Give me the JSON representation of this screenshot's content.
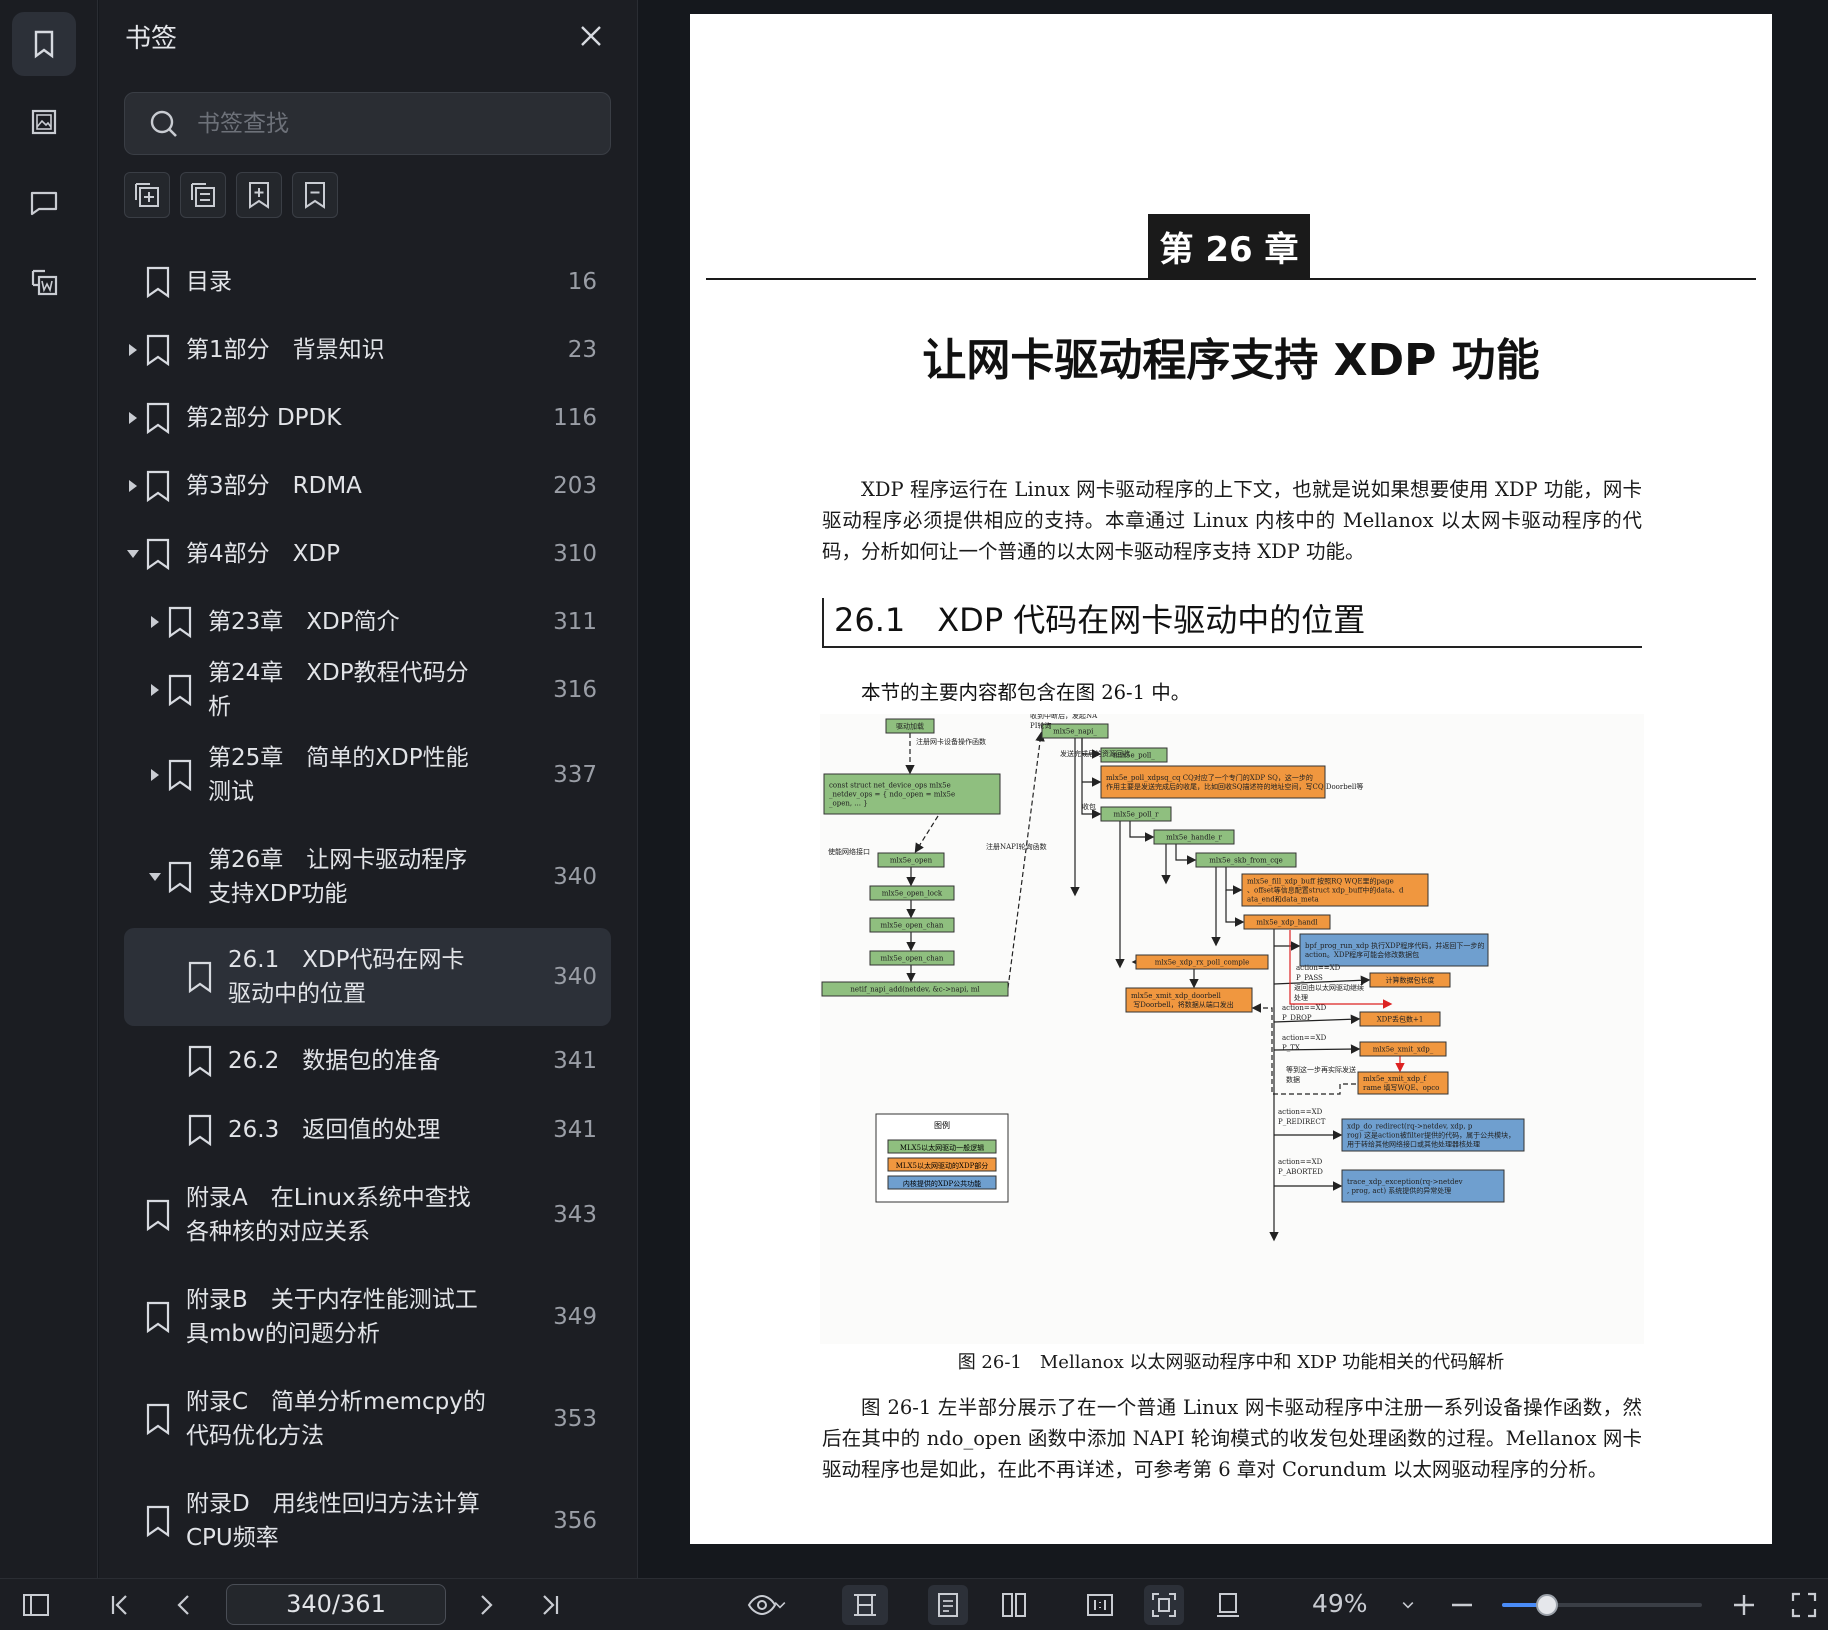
{
  "rail": {
    "items": [
      {
        "icon": "bookmark-icon",
        "active": true
      },
      {
        "icon": "image-icon",
        "active": false
      },
      {
        "icon": "comment-icon",
        "active": false
      },
      {
        "icon": "word-export-icon",
        "active": false
      }
    ]
  },
  "panel": {
    "title": "书签",
    "search_placeholder": "书签查找",
    "tools": [
      "add-bookmark-icon",
      "add-sub-bookmark-icon",
      "bookmark-plus-icon",
      "bookmark-remove-icon"
    ],
    "bookmarks": [
      {
        "label": "目录",
        "page": "16",
        "level": 0,
        "arrow": "none",
        "height": 68
      },
      {
        "label": "第1部分　背景知识",
        "page": "23",
        "level": 0,
        "arrow": "right",
        "height": 68
      },
      {
        "label": "第2部分 DPDK",
        "page": "116",
        "level": 0,
        "arrow": "right",
        "height": 68
      },
      {
        "label": "第3部分　RDMA",
        "page": "203",
        "level": 0,
        "arrow": "right",
        "height": 68
      },
      {
        "label": "第4部分　XDP",
        "page": "310",
        "level": 0,
        "arrow": "down",
        "height": 68
      },
      {
        "label": "第23章　XDP简介",
        "page": "311",
        "level": 1,
        "arrow": "right",
        "height": 68
      },
      {
        "label": "第24章　XDP教程代码分析",
        "page": "316",
        "level": 1,
        "arrow": "right",
        "height": 68
      },
      {
        "label": "第25章　简单的XDP性能测试",
        "page": "337",
        "level": 1,
        "arrow": "right",
        "height": 102
      },
      {
        "label": "第26章　让网卡驱动程序支持XDP功能",
        "page": "340",
        "level": 1,
        "arrow": "down",
        "height": 102
      },
      {
        "label": "26.1　XDP代码在网卡驱动中的位置",
        "page": "340",
        "level": 2,
        "arrow": "none",
        "height": 98,
        "selected": true
      },
      {
        "label": "26.2　数据包的准备",
        "page": "341",
        "level": 2,
        "arrow": "none",
        "height": 70
      },
      {
        "label": "26.3　返回值的处理",
        "page": "341",
        "level": 2,
        "arrow": "none",
        "height": 68
      },
      {
        "label": "附录A　在Linux系统中查找各种核的对应关系",
        "page": "343",
        "level": 0,
        "arrow": "none",
        "height": 102
      },
      {
        "label": "附录B　关于内存性能测试工具mbw的问题分析",
        "page": "349",
        "level": 0,
        "arrow": "none",
        "height": 102
      },
      {
        "label": "附录C　简单分析memcpy的代码优化方法",
        "page": "353",
        "level": 0,
        "arrow": "none",
        "height": 102
      },
      {
        "label": "附录D　用线性回归方法计算CPU频率",
        "page": "356",
        "level": 0,
        "arrow": "none",
        "height": 102
      }
    ]
  },
  "document": {
    "chapter_badge": "第 26 章",
    "chapter_title": "让网卡驱动程序支持 XDP 功能",
    "intro_paragraph": "XDP 程序运行在 Linux 网卡驱动程序的上下文，也就是说如果想要使用 XDP 功能，网卡驱动程序必须提供相应的支持。本章通过 Linux 内核中的 Mellanox 以太网卡驱动程序的代码，分析如何让一个普通的以太网卡驱动程序支持 XDP 功能。",
    "section_title": "26.1　XDP 代码在网卡驱动中的位置",
    "figure_intro": "本节的主要内容都包含在图 26-1 中。",
    "figure_caption": "图 26-1　Mellanox 以太网驱动程序中和 XDP 功能相关的代码解析",
    "body_paragraph": "图 26-1 左半部分展示了在一个普通 Linux 网卡驱动程序中注册一系列设备操作函数，然后在其中的 ndo_open 函数中添加 NAPI 轮询模式的收发包处理函数的过程。Mellanox 网卡驱动程序也是如此，在此不再详述，可参考第 6 章对 Corundum 以太网驱动程序的分析。",
    "figure": {
      "left_boxes": [
        {
          "text": "驱动加载"
        },
        {
          "text": "const struct net_device_ops mlx5e_netdev_ops = {  ndo_open = mlx5e_open,  ...  }"
        },
        {
          "text": "mlx5e_open"
        },
        {
          "text": "mlx5e_open_locked"
        },
        {
          "text": "mlx5e_open_channels"
        },
        {
          "text": "mlx5e_open_channel"
        },
        {
          "text": "netif_napi_add(netdev, &c->napi, mlx5e_napi_poll, 64)"
        }
      ],
      "left_labels": [
        "注册网卡设备操作函数",
        "使能网络接口",
        "注册NAPI轮询函数"
      ],
      "right_boxes": [
        {
          "text": "mlx5e_napi_poll",
          "kind": "green"
        },
        {
          "text": "mlx5e_poll_tx_cq",
          "kind": "green"
        },
        {
          "text": "mlx5e_poll_xdpsq_cq  CQ对应了一个专门的XDP SQ，这一步的作用主要是发送完成后的收尾，比如回收SQ描述符的地址空间，写CQ Doorbell等",
          "kind": "orange"
        },
        {
          "text": "mlx5e_poll_rx_cq",
          "kind": "green"
        },
        {
          "text": "mlx5e_handle_rx_cqe",
          "kind": "green"
        },
        {
          "text": "mlx5e_skb_from_cqe_linear",
          "kind": "green"
        },
        {
          "text": "mlx5e_fill_xdp_buff  按照RQ WQE里的page、offset等信息配置struct xdp_buff中的data、data_end和data_meta",
          "kind": "orange"
        },
        {
          "text": "mlx5e_xdp_handle",
          "kind": "orange"
        },
        {
          "text": "bpf_prog_run_xdp  执行XDP程序代码，并返回下一步的action。XDP程序可能会修改数据包",
          "kind": "blue"
        },
        {
          "text": "mlx5e_xdp_rx_poll_complete",
          "kind": "orange"
        },
        {
          "text": "mlx5e_xmit_xdp_doorbell  写Doorbell，将数据从端口发出",
          "kind": "orange"
        },
        {
          "text": "计算数据包长度",
          "kind": "orange"
        },
        {
          "text": "XDP丢包数+1",
          "kind": "orange"
        },
        {
          "text": "mlx5e_xmit_xdp_buff",
          "kind": "orange"
        },
        {
          "text": "mlx5e_xmit_xdp_frame  填写WQE、opcode等",
          "kind": "orange"
        },
        {
          "text": "xdp_do_redirect(rq->netdev, xdp, prog)  这是action被filter提供的代码，属于公共模块，用于转给其他网络接口或其他处理器核处理",
          "kind": "blue"
        },
        {
          "text": "trace_xdp_exception(rq->netdev, prog, act)  系统提供的异常处理",
          "kind": "blue"
        }
      ],
      "right_labels": [
        "收到中断后，发起NAPI轮询",
        "发送完成后的资源回收",
        "收包",
        "action==XDP_PASS",
        "返回由以太网驱动继续处理",
        "action==XDP_DROP",
        "action==XDP_TX",
        "等到这一步再实际发送数据",
        "action==XDP_REDIRECT",
        "action==XDP_ABORTED"
      ],
      "legend": {
        "title": "图例",
        "items": [
          "MLX5以太网驱动一般逻辑",
          "MLX5以太网驱动的XDP部分",
          "内核提供的XDP公共功能"
        ]
      },
      "colors": {
        "green": "#8fbf7f",
        "orange": "#f0973f",
        "blue": "#6f9fcf"
      }
    }
  },
  "toolbar": {
    "page_indicator": "340/361",
    "zoom": "49%",
    "zoom_fraction": 0.49
  }
}
